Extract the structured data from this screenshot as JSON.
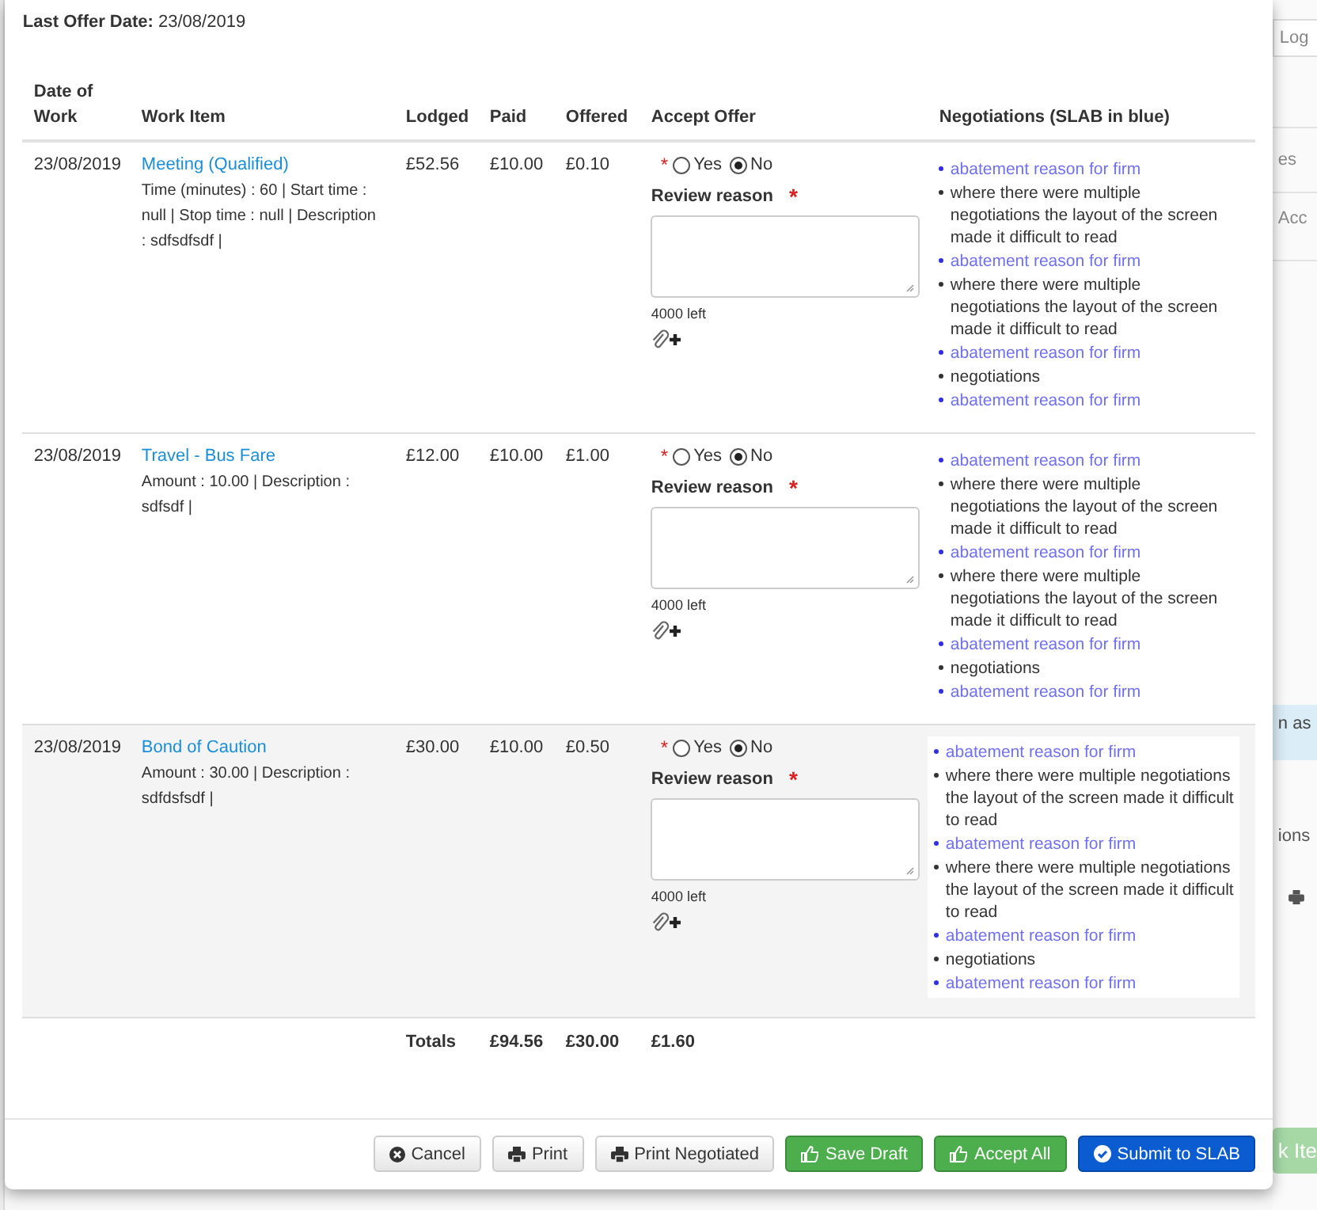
{
  "background": {
    "fragments": [
      {
        "text": "Log",
        "kind": "button"
      },
      {
        "text": "es",
        "kind": "text"
      },
      {
        "text": "Acc",
        "kind": "text"
      },
      {
        "text": "n as",
        "kind": "info"
      },
      {
        "text": "ions",
        "kind": "text"
      },
      {
        "text": "k Ite",
        "kind": "success"
      }
    ]
  },
  "modal": {
    "last_offer": {
      "label": "Last Offer Date:",
      "value": "23/08/2019"
    },
    "table": {
      "columns": [
        "Date of Work",
        "Work Item",
        "Lodged",
        "Paid",
        "Offered",
        "Accept Offer",
        "Negotiations (SLAB in blue)"
      ],
      "rows": [
        {
          "date": "23/08/2019",
          "title": "Meeting (Qualified)",
          "detail": "Time (minutes) : 60 | Start time : null | Stop time : null | Description : sdfsdfsdf |",
          "lodged": "£52.56",
          "paid": "£10.00",
          "offered": "£0.10",
          "highlighted": false,
          "required_mark": "*",
          "options": [
            {
              "label": "Yes",
              "selected": false
            },
            {
              "label": "No",
              "selected": true
            }
          ],
          "review_label": "Review reason",
          "review_mark": "*",
          "counter": "4000 left",
          "negotiations": [
            {
              "kind": "slab",
              "text": "abatement reason for firm"
            },
            {
              "kind": "firm",
              "text": "where there were multiple negotiations the layout of the screen made it difficult to read"
            },
            {
              "kind": "slab",
              "text": "abatement reason for firm"
            },
            {
              "kind": "firm",
              "text": "where there were multiple negotiations the layout of the screen made it difficult to read"
            },
            {
              "kind": "slab",
              "text": "abatement reason for firm"
            },
            {
              "kind": "firm",
              "text": "negotiations"
            },
            {
              "kind": "slab",
              "text": "abatement reason for firm"
            }
          ]
        },
        {
          "date": "23/08/2019",
          "title": "Travel - Bus Fare",
          "detail": "Amount : 10.00 | Description : sdfsdf |",
          "lodged": "£12.00",
          "paid": "£10.00",
          "offered": "£1.00",
          "highlighted": false,
          "required_mark": "*",
          "options": [
            {
              "label": "Yes",
              "selected": false
            },
            {
              "label": "No",
              "selected": true
            }
          ],
          "review_label": "Review reason",
          "review_mark": "*",
          "counter": "4000 left",
          "negotiations": [
            {
              "kind": "slab",
              "text": "abatement reason for firm"
            },
            {
              "kind": "firm",
              "text": "where there were multiple negotiations the layout of the screen made it difficult to read"
            },
            {
              "kind": "slab",
              "text": "abatement reason for firm"
            },
            {
              "kind": "firm",
              "text": "where there were multiple negotiations the layout of the screen made it difficult to read"
            },
            {
              "kind": "slab",
              "text": "abatement reason for firm"
            },
            {
              "kind": "firm",
              "text": "negotiations"
            },
            {
              "kind": "slab",
              "text": "abatement reason for firm"
            }
          ]
        },
        {
          "date": "23/08/2019",
          "title": "Bond of Caution",
          "detail": "Amount : 30.00 | Description : sdfdsfsdf |",
          "lodged": "£30.00",
          "paid": "£10.00",
          "offered": "£0.50",
          "highlighted": true,
          "required_mark": "*",
          "options": [
            {
              "label": "Yes",
              "selected": false
            },
            {
              "label": "No",
              "selected": true
            }
          ],
          "review_label": "Review reason",
          "review_mark": "*",
          "counter": "4000 left",
          "negotiations": [
            {
              "kind": "slab",
              "text": "abatement reason for firm"
            },
            {
              "kind": "firm",
              "text": "where there were multiple negotiations the layout of the screen made it difficult to read"
            },
            {
              "kind": "slab",
              "text": "abatement reason for firm"
            },
            {
              "kind": "firm",
              "text": "where there were multiple negotiations the layout of the screen made it difficult to read"
            },
            {
              "kind": "slab",
              "text": "abatement reason for firm"
            },
            {
              "kind": "firm",
              "text": "negotiations"
            },
            {
              "kind": "slab",
              "text": "abatement reason for firm"
            }
          ]
        }
      ],
      "totals": {
        "label": "Totals",
        "lodged": "£94.56",
        "paid": "£30.00",
        "offered": "£1.60"
      }
    },
    "buttons": [
      {
        "kind": "cancel",
        "label": "Cancel"
      },
      {
        "kind": "print",
        "label": "Print"
      },
      {
        "kind": "print",
        "label": "Print Negotiated"
      },
      {
        "kind": "save",
        "label": "Save Draft"
      },
      {
        "kind": "accept",
        "label": "Accept All"
      },
      {
        "kind": "submit",
        "label": "Submit to SLAB"
      }
    ]
  }
}
